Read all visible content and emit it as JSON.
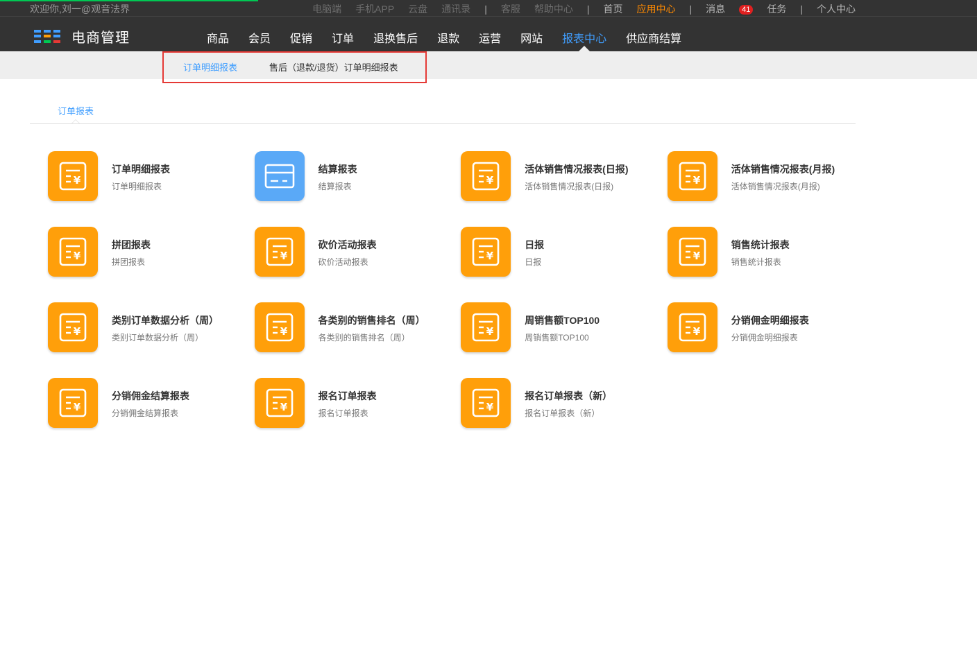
{
  "header": {
    "welcome": "欢迎你,刘一@观音法界",
    "links": {
      "pc": "电脑端",
      "app": "手机APP",
      "cloud": "云盘",
      "contacts": "通讯录",
      "service": "客服",
      "help": "帮助中心",
      "home": "首页",
      "app_center": "应用中心",
      "messages": "消息",
      "message_count": "41",
      "tasks": "任务",
      "profile": "个人中心",
      "separator": "|"
    },
    "logo_text": "电商管理",
    "nav": [
      "商品",
      "会员",
      "促销",
      "订单",
      "退换售后",
      "退款",
      "运营",
      "网站",
      "报表中心",
      "供应商结算"
    ],
    "active_nav": "报表中心"
  },
  "subnav": {
    "items": [
      "订单明细报表",
      "售后（退款/退货）订单明细报表"
    ]
  },
  "tab": {
    "label": "订单报表"
  },
  "colors": {
    "accent": "#409eff",
    "orange_icon": "#ff9f0a",
    "blue_icon": "#5aa9f7",
    "header_bg": "#333333",
    "app_center": "#ff8a00"
  },
  "reports": [
    {
      "title": "订单明细报表",
      "subtitle": "订单明细报表",
      "icon": "receipt-icon"
    },
    {
      "title": "结算报表",
      "subtitle": "结算报表",
      "icon": "card-icon"
    },
    {
      "title": "活体销售情况报表(日报)",
      "subtitle": "活体销售情况报表(日报)",
      "icon": "receipt-icon"
    },
    {
      "title": "活体销售情况报表(月报)",
      "subtitle": "活体销售情况报表(月报)",
      "icon": "receipt-icon"
    },
    {
      "title": "拼团报表",
      "subtitle": "拼团报表",
      "icon": "receipt-icon"
    },
    {
      "title": "砍价活动报表",
      "subtitle": "砍价活动报表",
      "icon": "receipt-icon"
    },
    {
      "title": "日报",
      "subtitle": "日报",
      "icon": "receipt-icon"
    },
    {
      "title": "销售统计报表",
      "subtitle": "销售统计报表",
      "icon": "receipt-icon"
    },
    {
      "title": "类别订单数据分析（周）",
      "subtitle": "类别订单数据分析（周）",
      "icon": "receipt-icon"
    },
    {
      "title": "各类别的销售排名（周）",
      "subtitle": "各类别的销售排名（周）",
      "icon": "receipt-icon"
    },
    {
      "title": "周销售额TOP100",
      "subtitle": "周销售额TOP100",
      "icon": "receipt-icon"
    },
    {
      "title": "分销佣金明细报表",
      "subtitle": "分销佣金明细报表",
      "icon": "receipt-icon"
    },
    {
      "title": "分销佣金结算报表",
      "subtitle": "分销佣金结算报表",
      "icon": "receipt-icon"
    },
    {
      "title": "报名订单报表",
      "subtitle": "报名订单报表",
      "icon": "receipt-icon"
    },
    {
      "title": "报名订单报表（新）",
      "subtitle": "报名订单报表（新）",
      "icon": "receipt-icon"
    }
  ]
}
